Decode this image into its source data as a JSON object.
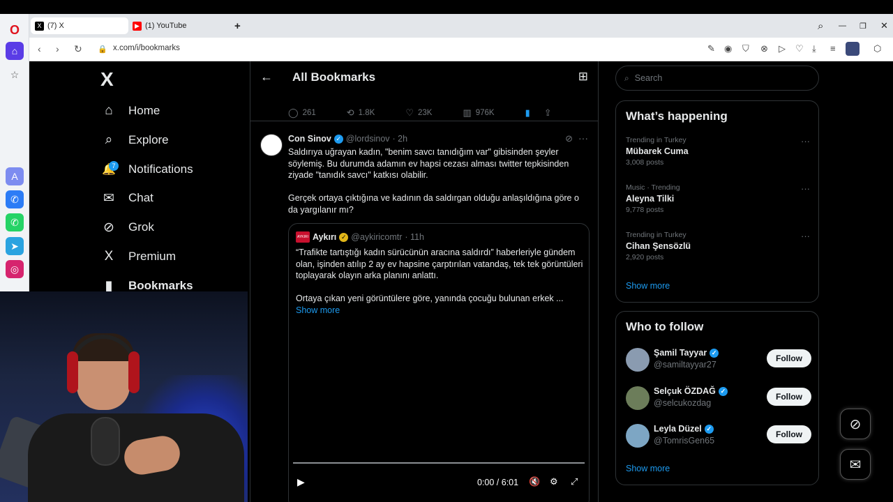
{
  "browser": {
    "tabs": [
      {
        "label": "(7) X",
        "favicon": "x-logo"
      },
      {
        "label": "(1) YouTube",
        "favicon": "youtube-logo"
      }
    ],
    "new_tab_glyph": "+",
    "url": "x.com/i/bookmarks",
    "window_controls": {
      "search": "⌕",
      "minimize": "—",
      "restore": "❐",
      "close": "✕"
    }
  },
  "left_nav": {
    "logo": "X",
    "items": [
      {
        "label": "Home",
        "icon": "home-icon",
        "glyph": "⌂"
      },
      {
        "label": "Explore",
        "icon": "search-icon",
        "glyph": "⌕"
      },
      {
        "label": "Notifications",
        "icon": "bell-icon",
        "glyph": "🔔",
        "badge": "7"
      },
      {
        "label": "Chat",
        "icon": "mail-icon",
        "glyph": "✉"
      },
      {
        "label": "Grok",
        "icon": "grok-icon",
        "glyph": "⊘"
      },
      {
        "label": "Premium",
        "icon": "x-icon",
        "glyph": "X"
      },
      {
        "label": "Bookmarks",
        "icon": "bookmark-icon",
        "glyph": "▮",
        "active": true
      }
    ]
  },
  "main": {
    "title": "All Bookmarks",
    "prev_stats": {
      "replies": "261",
      "reposts": "1.8K",
      "likes": "23K",
      "views": "976K"
    },
    "tweet": {
      "name": "Con Sinov",
      "handle": "@lordsinov",
      "time": "· 2h",
      "text": "Saldırıya uğrayan kadın, \"benim savcı tanıdığım var\" gibisinden şeyler söylemiş. Bu durumda adamın ev hapsi cezası alması twitter tepkisinden ziyade \"tanıdık savcı\" katkısı olabilir.\n\nGerçek ortaya çıktığına ve kadının da saldırgan olduğu anlaşıldığına göre o da yargılanır mı?",
      "quote": {
        "name": "Aykırı",
        "logo_text": "AYKIRI",
        "handle": "@aykiricomtr",
        "time": "· 11h",
        "text": "“Trafikte tartıştığı kadın sürücünün aracına saldırdı” haberleriyle gündem olan, işinden atılıp 2 ay ev hapsine çarptırılan vatandaş, tek tek görüntüleri toplayarak olayın arka planını anlattı.\n\nOrtaya çıkan yeni görüntülere göre, yanında çocuğu bulunan erkek ...",
        "show_more": "Show more",
        "video_time": "0:00 / 6:01",
        "video_progress": 0
      }
    }
  },
  "right": {
    "search_placeholder": "Search",
    "happening_title": "What’s happening",
    "trends": [
      {
        "category": "Trending in Turkey",
        "name": "Mübarek Cuma",
        "count": "3,008 posts"
      },
      {
        "category": "Music · Trending",
        "name": "Aleyna Tilki",
        "count": "9,778 posts"
      },
      {
        "category": "Trending in Turkey",
        "name": "Cihan Şensözlü",
        "count": "2,920 posts"
      }
    ],
    "trends_show_more": "Show more",
    "follow_title": "Who to follow",
    "follow": [
      {
        "name": "Şamil Tayyar",
        "handle": "@samiltayyar27",
        "button": "Follow",
        "avatar_color": "#8a9bb0"
      },
      {
        "name": "Selçuk ÖZDAĞ",
        "handle": "@selcukozdag",
        "button": "Follow",
        "avatar_color": "#6c7d5a"
      },
      {
        "name": "Leyla Düzel",
        "handle": "@TomrisGen65",
        "button": "Follow",
        "avatar_color": "#7da6c4"
      }
    ],
    "follow_show_more": "Show more"
  },
  "colors": {
    "accent": "#1d9bf0",
    "text": "#e7e9ea",
    "muted": "#71767b",
    "border": "#2f3336"
  }
}
